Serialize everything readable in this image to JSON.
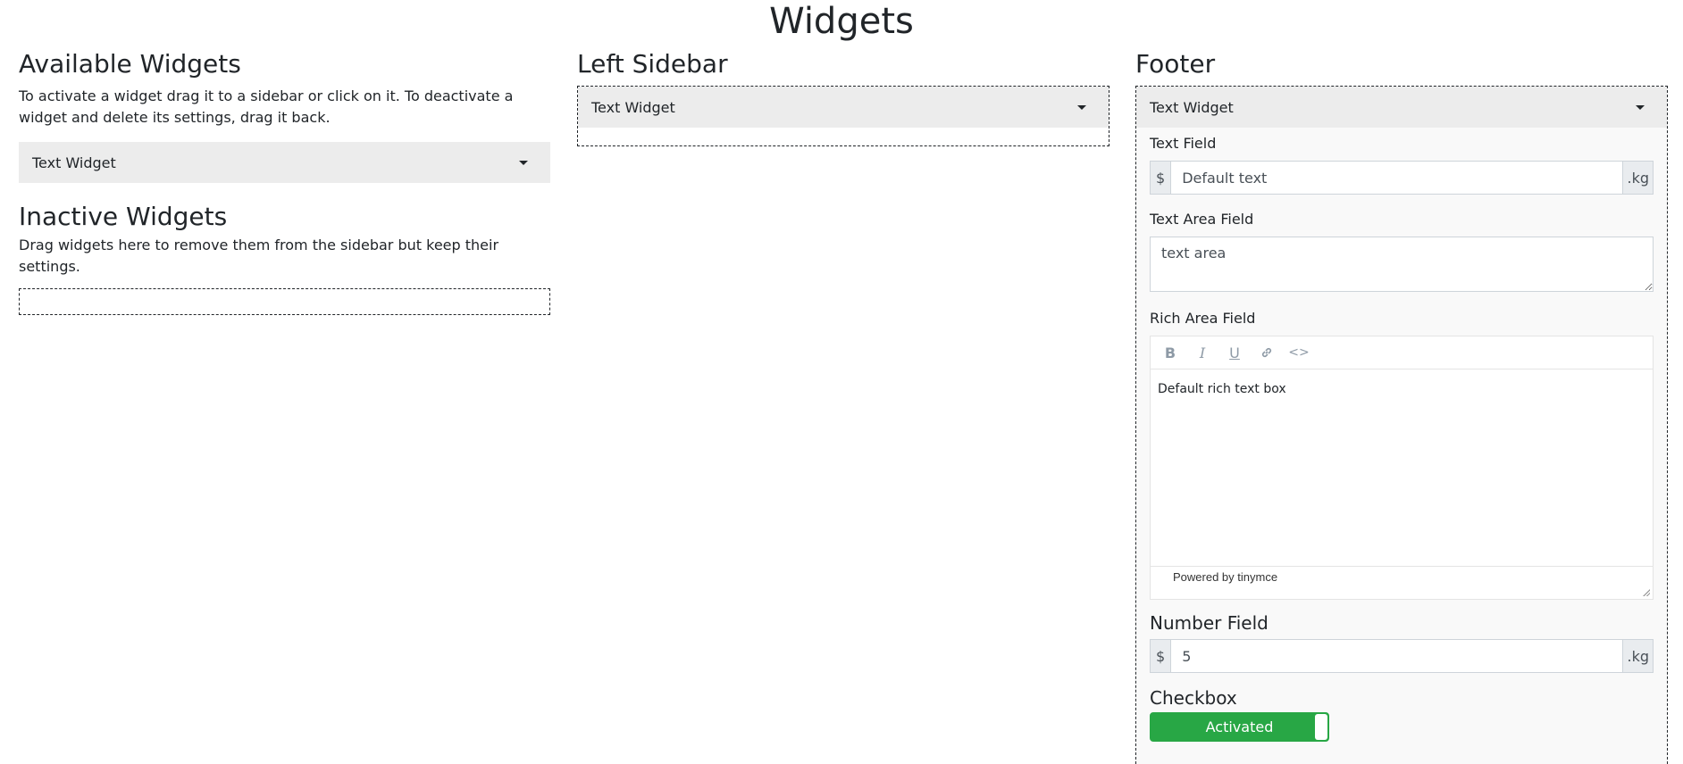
{
  "page_title": "Widgets",
  "available": {
    "heading": "Available Widgets",
    "description": "To activate a widget drag it to a sidebar or click on it. To deactivate a widget and delete its settings, drag it back.",
    "widget_label": "Text Widget"
  },
  "inactive": {
    "heading": "Inactive Widgets",
    "description": "Drag widgets here to remove them from the sidebar but keep their settings."
  },
  "left_sidebar": {
    "heading": "Left Sidebar",
    "widget_label": "Text Widget"
  },
  "footer": {
    "heading": "Footer",
    "widget_label": "Text Widget",
    "text_field": {
      "label": "Text Field",
      "prefix": "$",
      "suffix": ".kg",
      "value": "Default text"
    },
    "text_area": {
      "label": "Text Area Field",
      "value": "text area"
    },
    "rich_area": {
      "label": "Rich Area Field",
      "toolbar": [
        "bold-icon",
        "italic-icon",
        "underline-icon",
        "link-icon",
        "code-icon"
      ],
      "content": "Default rich text box",
      "status": "Powered by tinymce"
    },
    "number_field": {
      "label": "Number Field",
      "prefix": "$",
      "suffix": ".kg",
      "value": "5"
    },
    "checkbox": {
      "label": "Checkbox",
      "state_label": "Activated",
      "checked": true,
      "color": "#28a745"
    }
  }
}
